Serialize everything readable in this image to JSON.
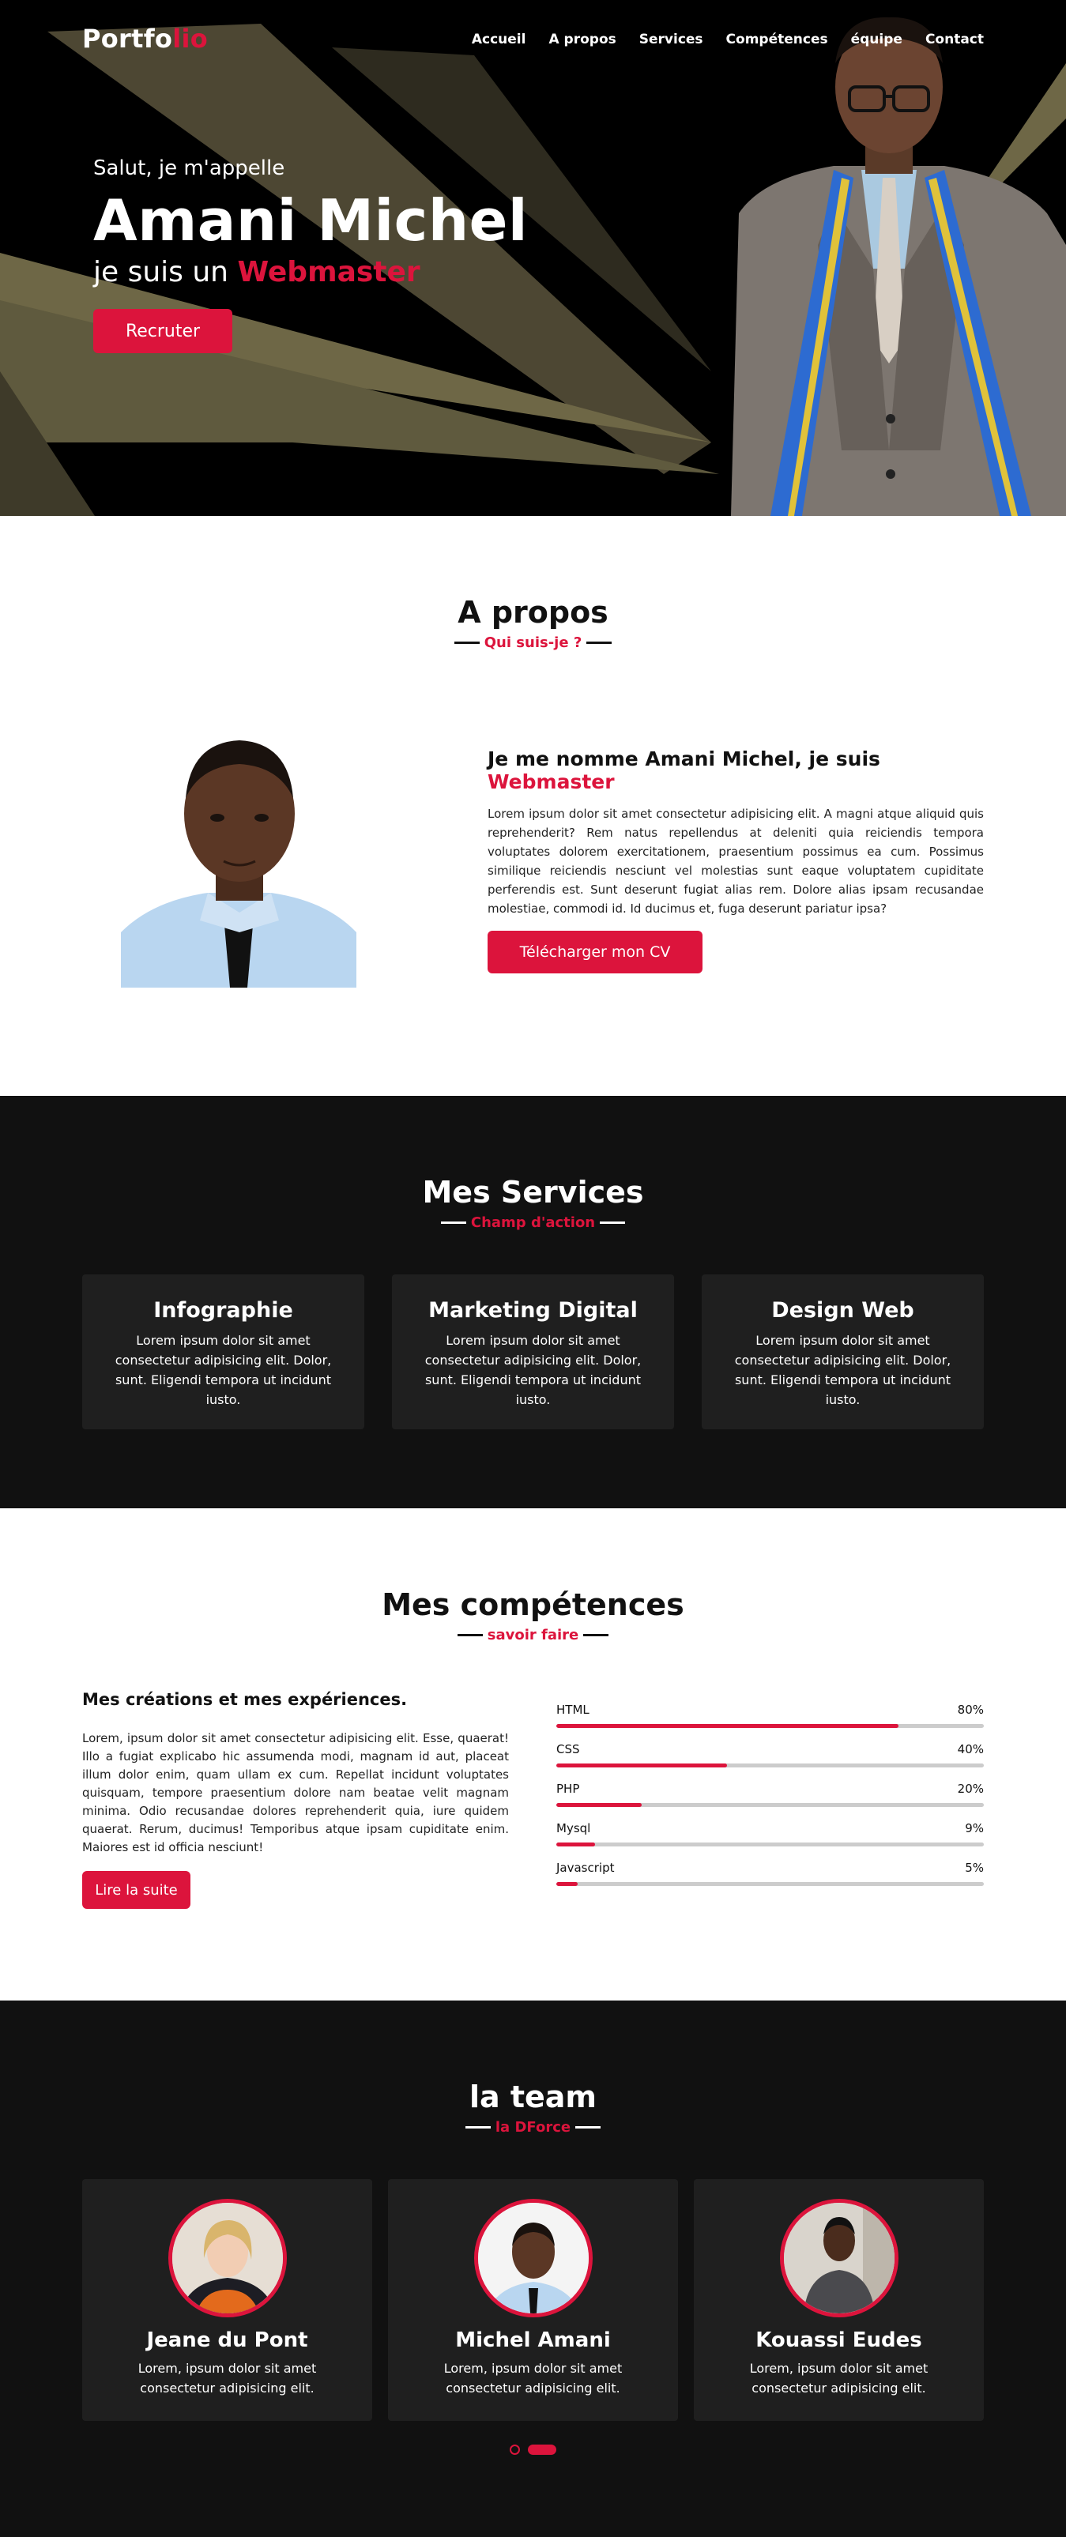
{
  "brand": {
    "logo_main": "Portfo",
    "logo_accent": "lio",
    "accent_color": "#dc143c"
  },
  "nav": [
    "Accueil",
    "A propos",
    "Services",
    "Compétences",
    "équipe",
    "Contact"
  ],
  "hero": {
    "greeting": "Salut, je m'appelle",
    "name": "Amani Michel",
    "role_prefix": "je suis un",
    "role": "Webmaster",
    "cta": "Recruter"
  },
  "about": {
    "title": "A propos",
    "subtitle": "Qui suis-je ?",
    "heading_prefix": "Je me nomme Amani Michel, je suis",
    "heading_accent": "Webmaster",
    "text": "Lorem ipsum dolor sit amet consectetur adipisicing elit. A magni atque aliquid quis reprehenderit? Rem natus repellendus at deleniti quia reiciendis tempora voluptates dolorem exercitationem, praesentium possimus ea cum. Possimus similique reiciendis nesciunt vel molestias sunt eaque voluptatem cupiditate perferendis est. Sunt deserunt fugiat alias rem. Dolore alias ipsam recusandae molestiae, commodi id. Id ducimus et, fuga deserunt pariatur ipsa?",
    "cta": "Télécharger mon CV"
  },
  "services": {
    "title": "Mes Services",
    "subtitle": "Champ d'action",
    "items": [
      {
        "title": "Infographie",
        "text": "Lorem ipsum dolor sit amet consectetur adipisicing elit. Dolor, sunt. Eligendi tempora ut incidunt iusto."
      },
      {
        "title": "Marketing Digital",
        "text": "Lorem ipsum dolor sit amet consectetur adipisicing elit. Dolor, sunt. Eligendi tempora ut incidunt iusto."
      },
      {
        "title": "Design Web",
        "text": "Lorem ipsum dolor sit amet consectetur adipisicing elit. Dolor, sunt. Eligendi tempora ut incidunt iusto."
      }
    ]
  },
  "skills": {
    "title": "Mes compétences",
    "subtitle": "savoir faire",
    "heading": "Mes créations et mes expériences.",
    "text": "Lorem, ipsum dolor sit amet consectetur adipisicing elit. Esse, quaerat! Illo a fugiat explicabo hic assumenda modi, magnam id aut, placeat illum dolor enim, quam ullam ex cum. Repellat incidunt voluptates quisquam, tempore praesentium dolore nam beatae velit magnam minima. Odio recusandae dolores reprehenderit quia, iure quidem quaerat. Rerum, ducimus! Temporibus atque ipsam cupiditate enim. Maiores est id officia nesciunt!",
    "cta": "Lire la suite",
    "items": [
      {
        "name": "HTML",
        "label": "80%",
        "level": 0.8
      },
      {
        "name": "CSS",
        "label": "40%",
        "level": 0.4
      },
      {
        "name": "PHP",
        "label": "20%",
        "level": 0.2
      },
      {
        "name": "Mysql",
        "label": "9%",
        "level": 0.09
      },
      {
        "name": "Javascript",
        "label": "5%",
        "level": 0.05
      }
    ]
  },
  "team": {
    "title": "la team",
    "subtitle": "la DForce",
    "members": [
      {
        "name": "Jeane du Pont",
        "text": "Lorem, ipsum dolor sit amet consectetur adipisicing elit."
      },
      {
        "name": "Michel Amani",
        "text": "Lorem, ipsum dolor sit amet consectetur adipisicing elit."
      },
      {
        "name": "Kouassi Eudes",
        "text": "Lorem, ipsum dolor sit amet consectetur adipisicing elit."
      }
    ]
  }
}
